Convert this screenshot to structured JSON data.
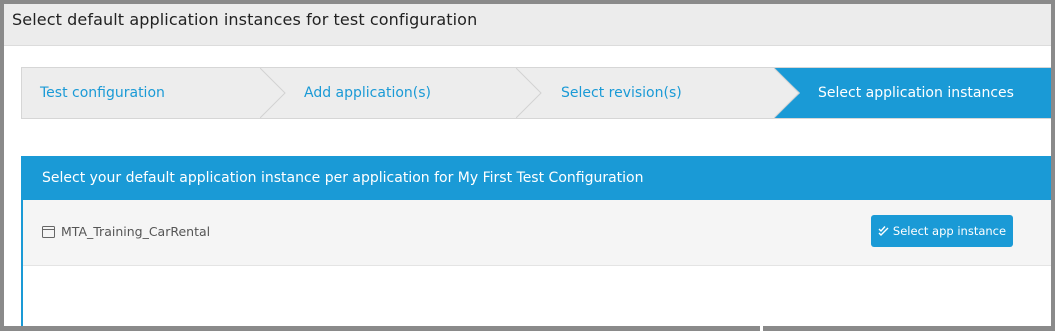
{
  "window": {
    "title": "Select default application instances for test configuration"
  },
  "steps": [
    {
      "label": "Test configuration",
      "active": false
    },
    {
      "label": "Add application(s)",
      "active": false
    },
    {
      "label": "Select revision(s)",
      "active": false
    },
    {
      "label": "Select application instances",
      "active": true
    }
  ],
  "panel": {
    "header": "Select your default application instance per application for My First Test Configuration",
    "applications": [
      {
        "name": "MTA_Training_CarRental",
        "icon": "calendar-icon"
      }
    ],
    "select_button_label": "Select app instance",
    "select_button_icon": "double-check-icon"
  },
  "colors": {
    "accent": "#1a9ad6",
    "step_bg": "#ededed",
    "title_bg": "#ececec"
  }
}
